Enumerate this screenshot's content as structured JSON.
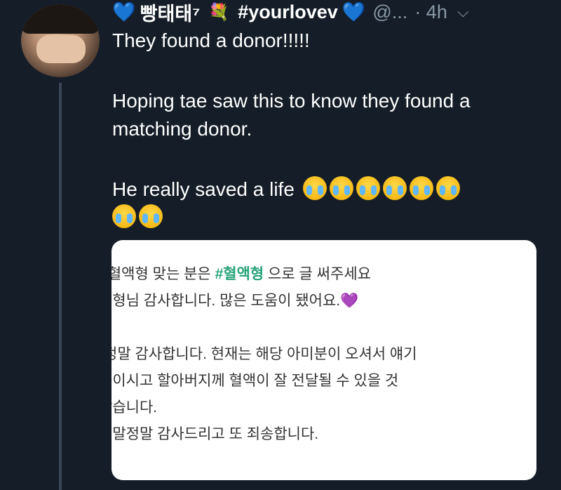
{
  "author": {
    "heart_left": "💙",
    "name": "빵태태⁷",
    "flower": "💐",
    "hashtag": "#yourlovev",
    "heart_right": "💙",
    "handle": "@...",
    "time": "· 4h",
    "menu_icon": "⌵"
  },
  "tweet": {
    "line1": "They found a donor!!!!!",
    "line2": "Hoping tae saw this to know they found a matching donor.",
    "line3": "He really saved a life",
    "emoji_count": 8,
    "emoji_name": "loudly-crying-face"
  },
  "card": {
    "l1_prefix": "- 혈액형 맞는 분은 ",
    "l1_hashtag": "#혈액형",
    "l1_suffix": " 으로 글 써주세요",
    "l2": "새형님 감사합니다. 많은 도움이 됐어요.",
    "l2_heart": "💜",
    "l3": "-정말 감사합니다. 현재는 해당 아미분이 오셔서 얘기",
    "l4": "중이시고 할아버지께 혈액이 잘 전달될 수 있을 것",
    "l5": "같습니다.",
    "l6": "정말정말 감사드리고 또 죄송합니다."
  },
  "colors": {
    "background": "#151d28",
    "secondary_text": "#8899a6",
    "heart_blue": "#3f8ee8",
    "hashtag_green": "#27a37a"
  }
}
